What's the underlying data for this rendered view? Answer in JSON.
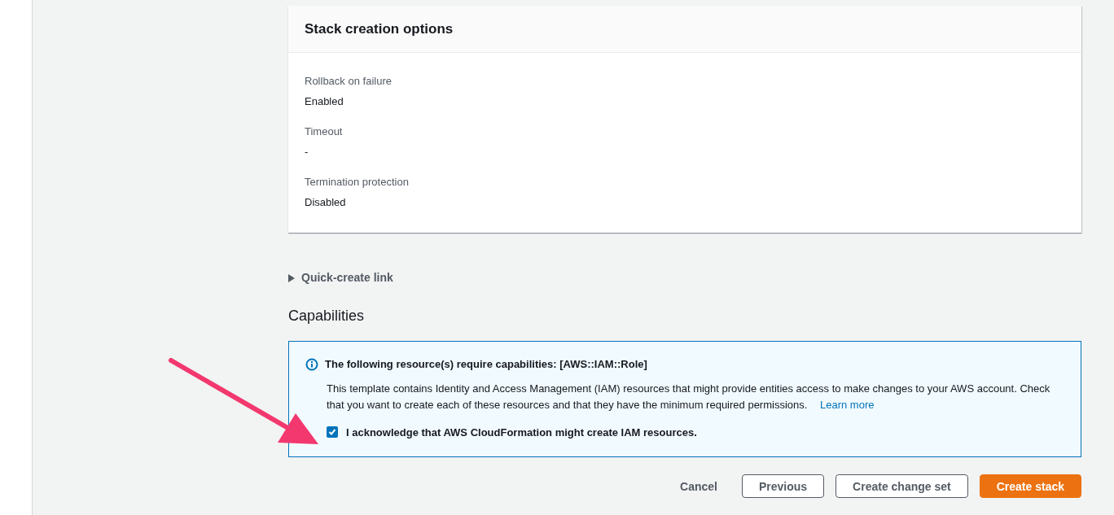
{
  "card": {
    "title": "Stack creation options",
    "fields": [
      {
        "label": "Rollback on failure",
        "value": "Enabled"
      },
      {
        "label": "Timeout",
        "value": "-"
      },
      {
        "label": "Termination protection",
        "value": "Disabled"
      }
    ]
  },
  "quick_create": {
    "label": "Quick-create link",
    "expanded": false
  },
  "capabilities": {
    "heading": "Capabilities",
    "alert": {
      "title": "The following resource(s) require capabilities: [AWS::IAM::Role]",
      "body": "This template contains Identity and Access Management (IAM) resources that might provide entities access to make changes to your AWS account. Check that you want to create each of these resources and that they have the minimum required permissions.",
      "link": "Learn more",
      "acknowledge": {
        "label": "I acknowledge that AWS CloudFormation might create IAM resources.",
        "checked": true
      }
    }
  },
  "buttons": [
    {
      "label": "Cancel",
      "kind": "link"
    },
    {
      "label": "Previous",
      "kind": "normal"
    },
    {
      "label": "Create change set",
      "kind": "normal"
    },
    {
      "label": "Create stack",
      "kind": "primary"
    }
  ]
}
